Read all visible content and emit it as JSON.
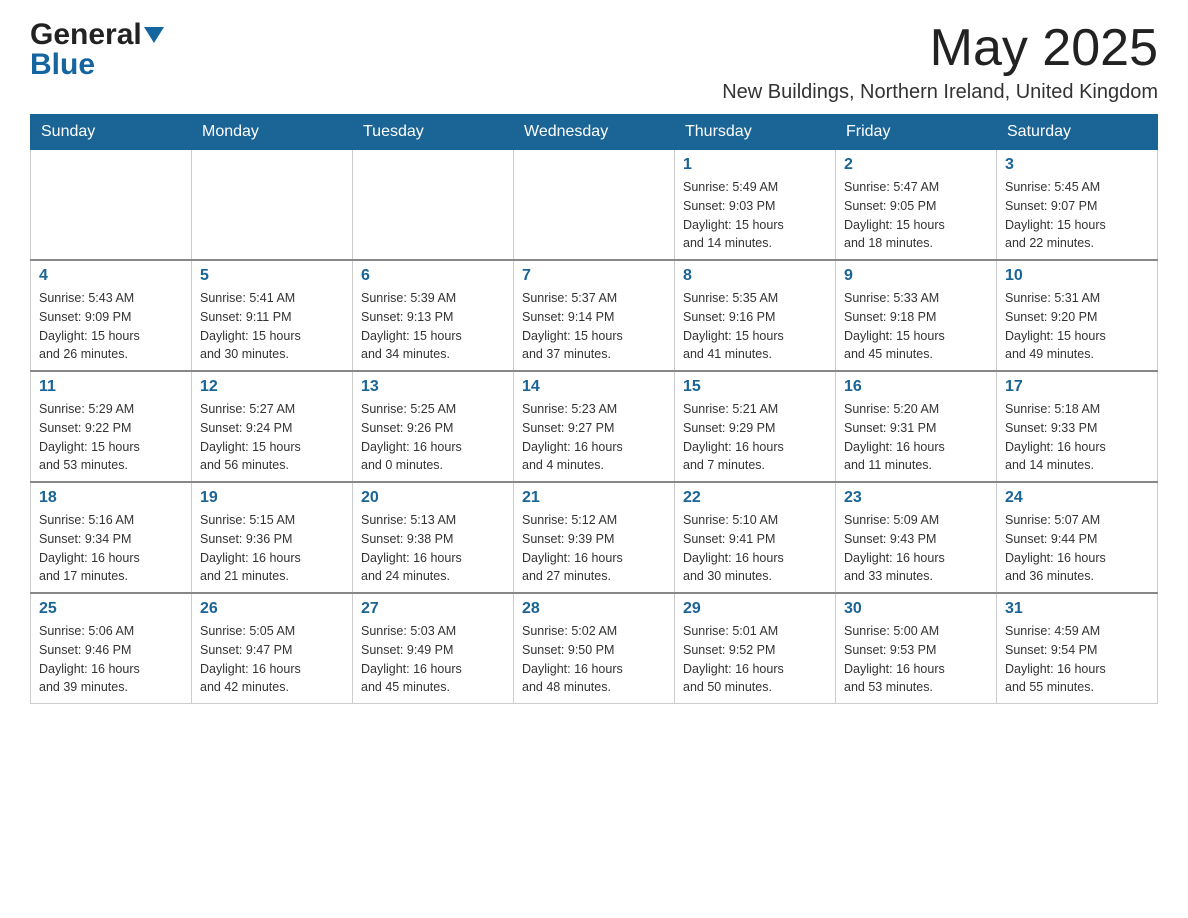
{
  "header": {
    "logo_general": "General",
    "logo_blue": "Blue",
    "month_title": "May 2025",
    "location": "New Buildings, Northern Ireland, United Kingdom"
  },
  "calendar": {
    "days_of_week": [
      "Sunday",
      "Monday",
      "Tuesday",
      "Wednesday",
      "Thursday",
      "Friday",
      "Saturday"
    ],
    "weeks": [
      [
        {
          "day": "",
          "info": ""
        },
        {
          "day": "",
          "info": ""
        },
        {
          "day": "",
          "info": ""
        },
        {
          "day": "",
          "info": ""
        },
        {
          "day": "1",
          "info": "Sunrise: 5:49 AM\nSunset: 9:03 PM\nDaylight: 15 hours\nand 14 minutes."
        },
        {
          "day": "2",
          "info": "Sunrise: 5:47 AM\nSunset: 9:05 PM\nDaylight: 15 hours\nand 18 minutes."
        },
        {
          "day": "3",
          "info": "Sunrise: 5:45 AM\nSunset: 9:07 PM\nDaylight: 15 hours\nand 22 minutes."
        }
      ],
      [
        {
          "day": "4",
          "info": "Sunrise: 5:43 AM\nSunset: 9:09 PM\nDaylight: 15 hours\nand 26 minutes."
        },
        {
          "day": "5",
          "info": "Sunrise: 5:41 AM\nSunset: 9:11 PM\nDaylight: 15 hours\nand 30 minutes."
        },
        {
          "day": "6",
          "info": "Sunrise: 5:39 AM\nSunset: 9:13 PM\nDaylight: 15 hours\nand 34 minutes."
        },
        {
          "day": "7",
          "info": "Sunrise: 5:37 AM\nSunset: 9:14 PM\nDaylight: 15 hours\nand 37 minutes."
        },
        {
          "day": "8",
          "info": "Sunrise: 5:35 AM\nSunset: 9:16 PM\nDaylight: 15 hours\nand 41 minutes."
        },
        {
          "day": "9",
          "info": "Sunrise: 5:33 AM\nSunset: 9:18 PM\nDaylight: 15 hours\nand 45 minutes."
        },
        {
          "day": "10",
          "info": "Sunrise: 5:31 AM\nSunset: 9:20 PM\nDaylight: 15 hours\nand 49 minutes."
        }
      ],
      [
        {
          "day": "11",
          "info": "Sunrise: 5:29 AM\nSunset: 9:22 PM\nDaylight: 15 hours\nand 53 minutes."
        },
        {
          "day": "12",
          "info": "Sunrise: 5:27 AM\nSunset: 9:24 PM\nDaylight: 15 hours\nand 56 minutes."
        },
        {
          "day": "13",
          "info": "Sunrise: 5:25 AM\nSunset: 9:26 PM\nDaylight: 16 hours\nand 0 minutes."
        },
        {
          "day": "14",
          "info": "Sunrise: 5:23 AM\nSunset: 9:27 PM\nDaylight: 16 hours\nand 4 minutes."
        },
        {
          "day": "15",
          "info": "Sunrise: 5:21 AM\nSunset: 9:29 PM\nDaylight: 16 hours\nand 7 minutes."
        },
        {
          "day": "16",
          "info": "Sunrise: 5:20 AM\nSunset: 9:31 PM\nDaylight: 16 hours\nand 11 minutes."
        },
        {
          "day": "17",
          "info": "Sunrise: 5:18 AM\nSunset: 9:33 PM\nDaylight: 16 hours\nand 14 minutes."
        }
      ],
      [
        {
          "day": "18",
          "info": "Sunrise: 5:16 AM\nSunset: 9:34 PM\nDaylight: 16 hours\nand 17 minutes."
        },
        {
          "day": "19",
          "info": "Sunrise: 5:15 AM\nSunset: 9:36 PM\nDaylight: 16 hours\nand 21 minutes."
        },
        {
          "day": "20",
          "info": "Sunrise: 5:13 AM\nSunset: 9:38 PM\nDaylight: 16 hours\nand 24 minutes."
        },
        {
          "day": "21",
          "info": "Sunrise: 5:12 AM\nSunset: 9:39 PM\nDaylight: 16 hours\nand 27 minutes."
        },
        {
          "day": "22",
          "info": "Sunrise: 5:10 AM\nSunset: 9:41 PM\nDaylight: 16 hours\nand 30 minutes."
        },
        {
          "day": "23",
          "info": "Sunrise: 5:09 AM\nSunset: 9:43 PM\nDaylight: 16 hours\nand 33 minutes."
        },
        {
          "day": "24",
          "info": "Sunrise: 5:07 AM\nSunset: 9:44 PM\nDaylight: 16 hours\nand 36 minutes."
        }
      ],
      [
        {
          "day": "25",
          "info": "Sunrise: 5:06 AM\nSunset: 9:46 PM\nDaylight: 16 hours\nand 39 minutes."
        },
        {
          "day": "26",
          "info": "Sunrise: 5:05 AM\nSunset: 9:47 PM\nDaylight: 16 hours\nand 42 minutes."
        },
        {
          "day": "27",
          "info": "Sunrise: 5:03 AM\nSunset: 9:49 PM\nDaylight: 16 hours\nand 45 minutes."
        },
        {
          "day": "28",
          "info": "Sunrise: 5:02 AM\nSunset: 9:50 PM\nDaylight: 16 hours\nand 48 minutes."
        },
        {
          "day": "29",
          "info": "Sunrise: 5:01 AM\nSunset: 9:52 PM\nDaylight: 16 hours\nand 50 minutes."
        },
        {
          "day": "30",
          "info": "Sunrise: 5:00 AM\nSunset: 9:53 PM\nDaylight: 16 hours\nand 53 minutes."
        },
        {
          "day": "31",
          "info": "Sunrise: 4:59 AM\nSunset: 9:54 PM\nDaylight: 16 hours\nand 55 minutes."
        }
      ]
    ]
  }
}
